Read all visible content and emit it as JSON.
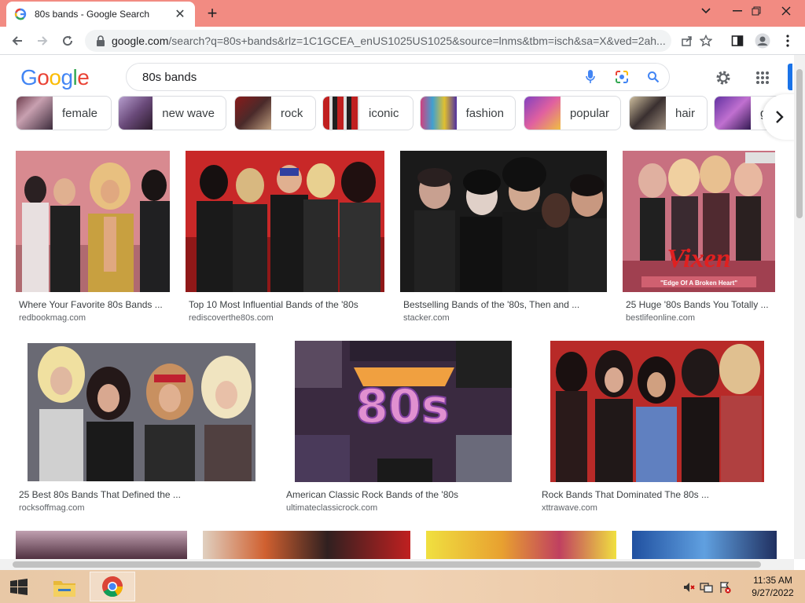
{
  "browser": {
    "tab_title": "80s bands - Google Search",
    "tab_close": "✕",
    "new_tab": "+",
    "url_host": "google.com",
    "url_rest": "/search?q=80s+bands&rlz=1C1GCEA_enUS1025US1025&source=lnms&tbm=isch&sa=X&ved=2ah...",
    "colors": {
      "tabstrip": "#f28b82",
      "accent": "#1a73e8"
    }
  },
  "google": {
    "logo": [
      "G",
      "o",
      "o",
      "g",
      "l",
      "e"
    ],
    "query": "80s bands"
  },
  "chips": [
    {
      "label": "female"
    },
    {
      "label": "new wave"
    },
    {
      "label": "rock"
    },
    {
      "label": "iconic"
    },
    {
      "label": "fashion"
    },
    {
      "label": "popular"
    },
    {
      "label": "hair"
    },
    {
      "label": "g"
    }
  ],
  "results": [
    {
      "caption": "Where Your Favorite 80s Bands ...",
      "source": "redbookmag.com"
    },
    {
      "caption": "Top 10 Most Influential Bands of the '80s",
      "source": "rediscoverthe80s.com"
    },
    {
      "caption": "Bestselling Bands of the '80s, Then and ...",
      "source": "stacker.com"
    },
    {
      "caption": "25 Huge '80s Bands You Totally ...",
      "source": "bestlifeonline.com"
    },
    {
      "caption": "25 Best 80s Bands That Defined the ...",
      "source": "rocksoffmag.com"
    },
    {
      "caption": "American Classic Rock Bands of the '80s",
      "source": "ultimateclassicrock.com"
    },
    {
      "caption": "Rock Bands That Dominated The 80s ...",
      "source": "xttrawave.com"
    }
  ],
  "image_text": {
    "vixen_logo": "Vixen",
    "vixen_album": "\"Edge Of A Broken Heart\"",
    "eighties_logo": "80s"
  },
  "taskbar": {
    "time": "11:35 AM",
    "date": "9/27/2022"
  }
}
